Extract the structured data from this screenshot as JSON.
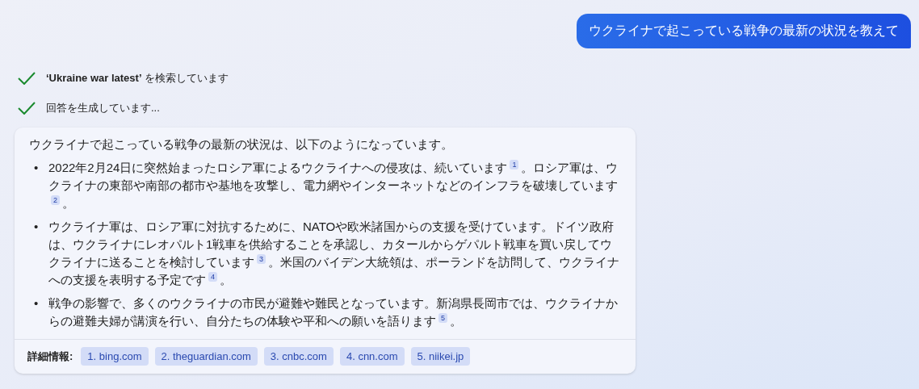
{
  "user_message": "ウクライナで起こっている戦争の最新の状況を教えて",
  "steps": [
    {
      "text": "**‘Ukraine war latest’** を検索しています",
      "done": true
    },
    {
      "text": "回答を生成しています...",
      "done": true
    }
  ],
  "answer": {
    "intro": "ウクライナで起こっている戦争の最新の状況は、以下のようになっています。",
    "bullets": [
      {
        "marker": "•",
        "parts": [
          {
            "text": "2022年2月24日に突然始まったロシア軍によるウクライナへの侵攻は、続いています",
            "cite": "1"
          },
          {
            "text": "。ロシア軍は、ウクライナの東部や南部の都市や基地を攻撃し、電力網やインターネットなどのインフラを破壊しています",
            "cite": "2"
          },
          {
            "text": "。"
          }
        ]
      },
      {
        "marker": "•",
        "parts": [
          {
            "text": "ウクライナ軍は、ロシア軍に対抗するために、NATOや欧米諸国からの支援を受けています。ドイツ政府は、ウクライナにレオパルト1戦車を供給することを承認し、カタールからゲパルト戦車を買い戻してウクライナに送ることを検討しています",
            "cite": "3"
          },
          {
            "text": "。米国のバイデン大統領は、ポーランドを訪問して、ウクライナへの支援を表明する予定です",
            "cite": "4"
          },
          {
            "text": "。"
          }
        ]
      },
      {
        "marker": "•",
        "parts": [
          {
            "text": "戦争の影響で、多くのウクライナの市民が避難や難民となっています。新潟県長岡市では、ウクライナからの避難夫婦が講演を行い、自分たちの体験や平和への願いを語ります",
            "cite": "5"
          },
          {
            "text": "。"
          }
        ]
      }
    ],
    "sources_label": "詳細情報:",
    "sources": [
      "1. bing.com",
      "2. theguardian.com",
      "3. cnbc.com",
      "4. cnn.com",
      "5. niikei.jp"
    ]
  }
}
